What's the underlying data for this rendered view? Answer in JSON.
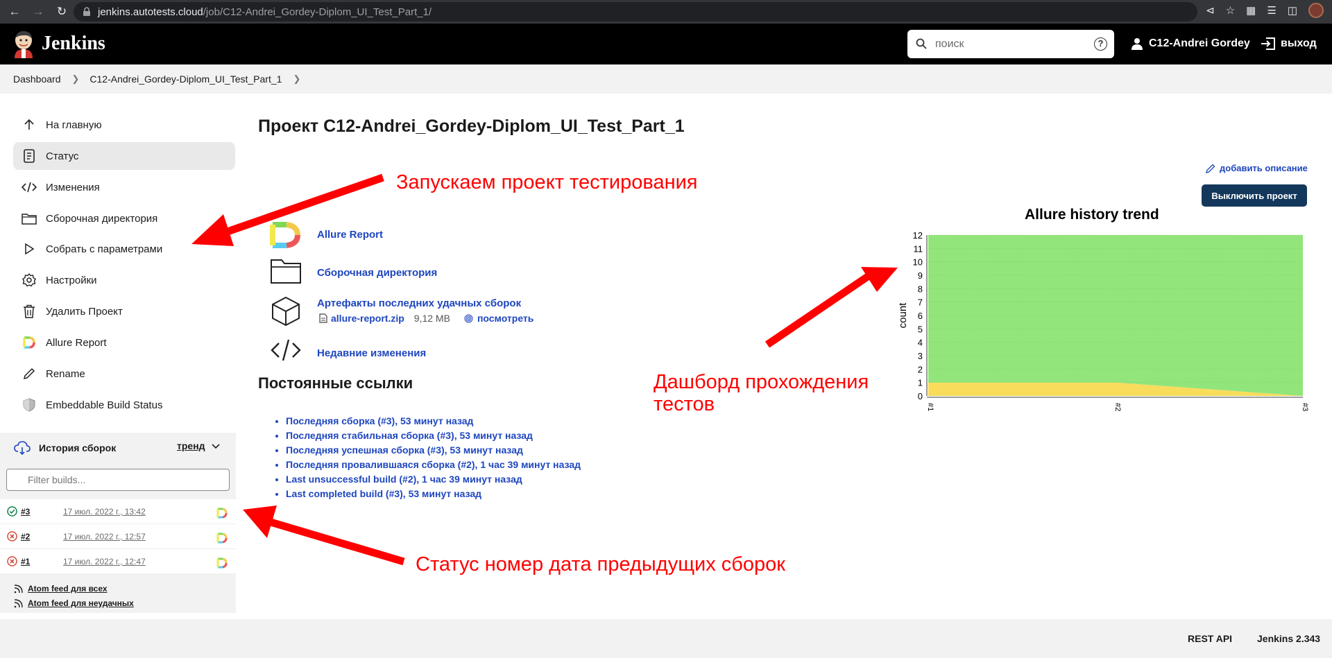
{
  "browser": {
    "url_host": "jenkins.autotests.cloud",
    "url_path": "/job/C12-Andrei_Gordey-Diplom_UI_Test_Part_1/"
  },
  "header": {
    "title": "Jenkins",
    "search_placeholder": "поиск",
    "user_name": "C12-Andrei Gordey",
    "logout_label": "выход"
  },
  "breadcrumb": {
    "items": [
      "Dashboard",
      "C12-Andrei_Gordey-Diplom_UI_Test_Part_1"
    ]
  },
  "sidebar": {
    "tasks": [
      {
        "label": "На главную",
        "icon": "arrow-up-icon"
      },
      {
        "label": "Статус",
        "icon": "document-icon"
      },
      {
        "label": "Изменения",
        "icon": "code-icon"
      },
      {
        "label": "Сборочная директория",
        "icon": "folder-icon"
      },
      {
        "label": "Собрать с параметрами",
        "icon": "play-icon"
      },
      {
        "label": "Настройки",
        "icon": "gear-icon"
      },
      {
        "label": "Удалить Проект",
        "icon": "trash-icon"
      },
      {
        "label": "Allure Report",
        "icon": "allure-icon"
      },
      {
        "label": "Rename",
        "icon": "pencil-icon"
      },
      {
        "label": "Embeddable Build Status",
        "icon": "shield-icon"
      }
    ],
    "history": {
      "title": "История сборок",
      "trend_label": "тренд",
      "filter_placeholder": "Filter builds...",
      "builds": [
        {
          "number": "#3",
          "date": "17 июл. 2022 г., 13:42",
          "status": "success"
        },
        {
          "number": "#2",
          "date": "17 июл. 2022 г., 12:57",
          "status": "failed"
        },
        {
          "number": "#1",
          "date": "17 июл. 2022 г., 12:47",
          "status": "failed"
        }
      ],
      "feed_all": "Atom feed для всех",
      "feed_failed": "Atom feed для неудачных"
    }
  },
  "main": {
    "title": "Проект C12-Andrei_Gordey-Diplom_UI_Test_Part_1",
    "add_description": "добавить описание",
    "disable_button": "Выключить проект",
    "links": {
      "allure": "Allure Report",
      "workspace": "Сборочная директория",
      "artifacts": "Артефакты последних удачных сборок",
      "artifact_file": "allure-report.zip",
      "artifact_size": "9,12 MB",
      "artifact_view": "посмотреть",
      "changes": "Недавние изменения"
    },
    "permalinks_title": "Постоянные ссылки",
    "permalinks": [
      "Последняя сборка (#3), 53 минут назад",
      "Последняя стабильная сборка (#3), 53 минут назад",
      "Последняя успешная сборка (#3), 53 минут назад",
      "Последняя провалившаяся сборка (#2), 1 час 39 минут назад",
      "Last unsuccessful build (#2), 1 час 39 минут назад",
      "Last completed build (#3), 53 минут назад"
    ]
  },
  "chart_data": {
    "type": "area",
    "title": "Allure history trend",
    "ylabel": "count",
    "xlabel": "",
    "categories": [
      "#1",
      "#2",
      "#3"
    ],
    "ylim": [
      0,
      12
    ],
    "yticks": [
      0,
      1,
      2,
      3,
      4,
      5,
      6,
      7,
      8,
      9,
      10,
      11,
      12
    ],
    "series": [
      {
        "values": [
          1,
          1,
          0
        ],
        "color": "#f9dc5c"
      },
      {
        "values": [
          11,
          11,
          12
        ],
        "color": "#92e57b"
      }
    ]
  },
  "annotations": {
    "launch": "Запускаем проект тестирования",
    "dashboard_line1": "Дашборд прохождения",
    "dashboard_line2": "тестов",
    "status": "Статус номер дата предыдущих сборок"
  },
  "footer": {
    "rest_api": "REST API",
    "version": "Jenkins 2.343"
  },
  "colors": {
    "link": "#1e46be",
    "header_bg": "#000000",
    "annotation": "#ff0000",
    "button_bg": "#14385c"
  }
}
